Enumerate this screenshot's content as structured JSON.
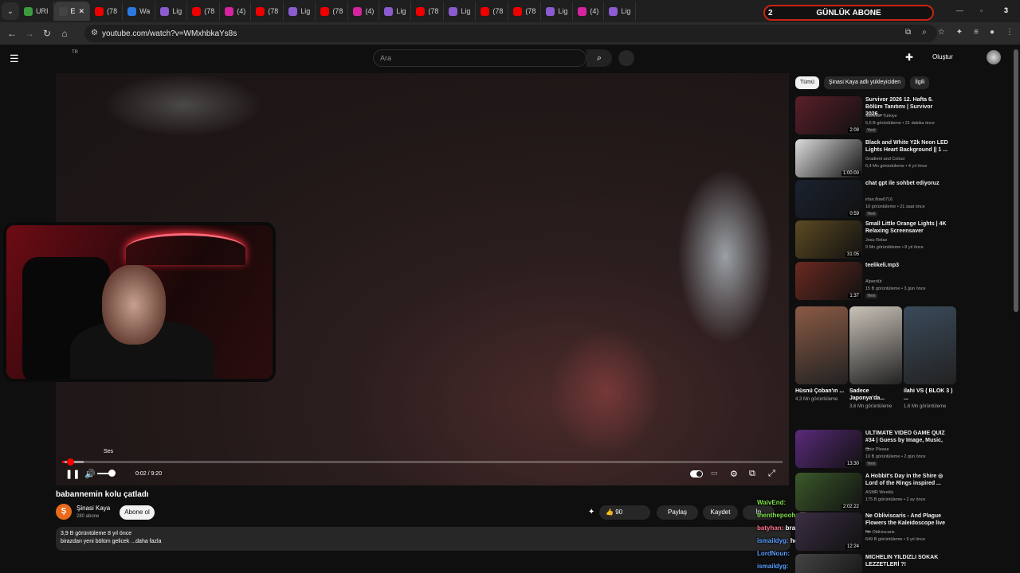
{
  "browser": {
    "tabs": [
      {
        "label": "URI",
        "color": "#3c9c3c"
      },
      {
        "label": "E",
        "color": "#444",
        "active": true
      },
      {
        "label": "(78",
        "color": "#e00"
      },
      {
        "label": "Wa",
        "color": "#2a7ae2"
      },
      {
        "label": "Lig",
        "color": "#8a5cd0"
      },
      {
        "label": "(78",
        "color": "#e00"
      },
      {
        "label": "(4)",
        "color": "#d6249f"
      },
      {
        "label": "(78",
        "color": "#e00"
      },
      {
        "label": "Lig",
        "color": "#8a5cd0"
      },
      {
        "label": "(78",
        "color": "#e00"
      },
      {
        "label": "(4)",
        "color": "#d6249f"
      },
      {
        "label": "Lig",
        "color": "#8a5cd0"
      },
      {
        "label": "(78",
        "color": "#e00"
      },
      {
        "label": "Lig",
        "color": "#8a5cd0"
      },
      {
        "label": "(78",
        "color": "#e00"
      },
      {
        "label": "(78",
        "color": "#e00"
      },
      {
        "label": "Lig",
        "color": "#8a5cd0"
      },
      {
        "label": "(4)",
        "color": "#d6249f"
      },
      {
        "label": "Lig",
        "color": "#8a5cd0"
      }
    ],
    "banner_label": "GÜNLÜK ABONE",
    "banner_left": "2",
    "banner_right": "3",
    "url": "youtube.com/watch?v=WMxhbkaYs8s"
  },
  "youtube": {
    "region": "TR",
    "search_placeholder": "Ara",
    "create_label": "Oluştur"
  },
  "player": {
    "volume_tooltip": "Ses",
    "time": "0:02 / 9:20",
    "progress_fraction": 0.0036,
    "buffer_fraction": 0.03,
    "volume_fraction": 0.6
  },
  "video": {
    "title": "babannemin kolu çatladı",
    "channel": "Şinasi Kaya",
    "channel_initial": "Ş",
    "subscribers": "280 abone",
    "subscribe_label": "Abone ol",
    "likes": "90",
    "share_label": "Paylaş",
    "save_label": "Kaydet",
    "more_label": "İn",
    "views_line": "3,9 B görüntüleme  8 yıl önce",
    "description": "birazdan yeni bölüm gelicek ...daha fazla"
  },
  "chat": [
    {
      "user": "WaivEnd:",
      "color": "#7fe04a",
      "message": ""
    },
    {
      "user": "thenthepooh:",
      "color": "#7fe04a",
      "message": "🐻"
    },
    {
      "user": "batyhan:",
      "color": "#ff6f8a",
      "message": "bravo zoktay"
    },
    {
      "user": "ismaildyg:",
      "color": "#5aa0ff",
      "message": "hepsi proje hepsi"
    },
    {
      "user": "LordNoun:",
      "color": "#5aa0ff",
      "message": ""
    },
    {
      "user": "ismaildyg:",
      "color": "#5aa0ff",
      "message": ""
    }
  ],
  "sidebar": {
    "chips": [
      "Tümü",
      "Şinasi Kaya adlı yükleyiciden",
      "İlgili"
    ],
    "recs_top": [
      {
        "title": "Survivor 2026 12. Hafta 6. Bölüm Tanıtımı | Survivor 2026...",
        "channel": "Survivor Türkiye",
        "meta": "5,6 B görüntüleme • 21 dakika önce",
        "badge": "Yeni",
        "duration": "2:09",
        "thumb": "#5b1f2a"
      },
      {
        "title": "Black and White Y2k Neon LED Lights Heart Background || 1 ...",
        "channel": "Gradient and Colour",
        "meta": "6,4 Mn görüntüleme • 4 yıl önce",
        "badge": "",
        "duration": "1:00:00",
        "thumb": "#ddd"
      },
      {
        "title": "chat gpt ile sohbet ediyoruz",
        "channel": "irfan.flow0716",
        "meta": "10 görüntüleme • 21 saat önce",
        "badge": "Yeni",
        "duration": "0:59",
        "thumb": "#1b2230"
      },
      {
        "title": "Small Little Orange Lights | 4K Relaxing Screensaver",
        "channel": "Josu Relax",
        "meta": "9 Mn görüntüleme • 8 yıl önce",
        "badge": "",
        "duration": "31:05",
        "thumb": "#5c4a22"
      },
      {
        "title": "teelikeli.mp3",
        "channel": "Alperdüt",
        "meta": "15 B görüntüleme • 3 gün önce",
        "badge": "Yeni",
        "duration": "1:37",
        "thumb": "#6a2a20"
      }
    ],
    "shorts": [
      {
        "title": "Hüsnü Çoban'ın ...",
        "views": "4,3 Mn görüntüleme",
        "thumb": "#8a5a44"
      },
      {
        "title": "Sadece Japonya'da...",
        "views": "3,6 Mn görüntüleme",
        "thumb": "#c9c2b8"
      },
      {
        "title": "ilahi VS ( BLOK 3 ) ...",
        "views": "1,6 Mn görüntüleme",
        "thumb": "#3a4a5a"
      }
    ],
    "recs_bottom": [
      {
        "title": "ULTIMATE VIDEO GAME QUIZ #34 | Guess by Image, Music, ...",
        "channel": "Quiz Please",
        "meta": "10 B görüntüleme • 2 gün önce",
        "badge": "Yeni",
        "duration": "13:30",
        "thumb": "#5a2a7a"
      },
      {
        "title": "A Hobbit's Day in the Shire ◎ Lord of the Rings inspired ...",
        "channel": "ASMR Weekly",
        "meta": "175 B görüntüleme • 2 ay önce",
        "badge": "",
        "duration": "2:02:22",
        "thumb": "#3b5a2a"
      },
      {
        "title": "Ne Obliviscaris - And Plague Flowers the Kaleidoscope live ...",
        "channel": "Ne Obliviscaris",
        "meta": "649 B görüntüleme • 9 yıl önce",
        "badge": "",
        "duration": "12:24",
        "thumb": "#3a2e44"
      },
      {
        "title": "MICHELIN YILDIZLI SOKAK LEZZETLERİ ?!",
        "channel": "",
        "meta": "",
        "badge": "",
        "duration": "",
        "thumb": "#444"
      }
    ]
  }
}
